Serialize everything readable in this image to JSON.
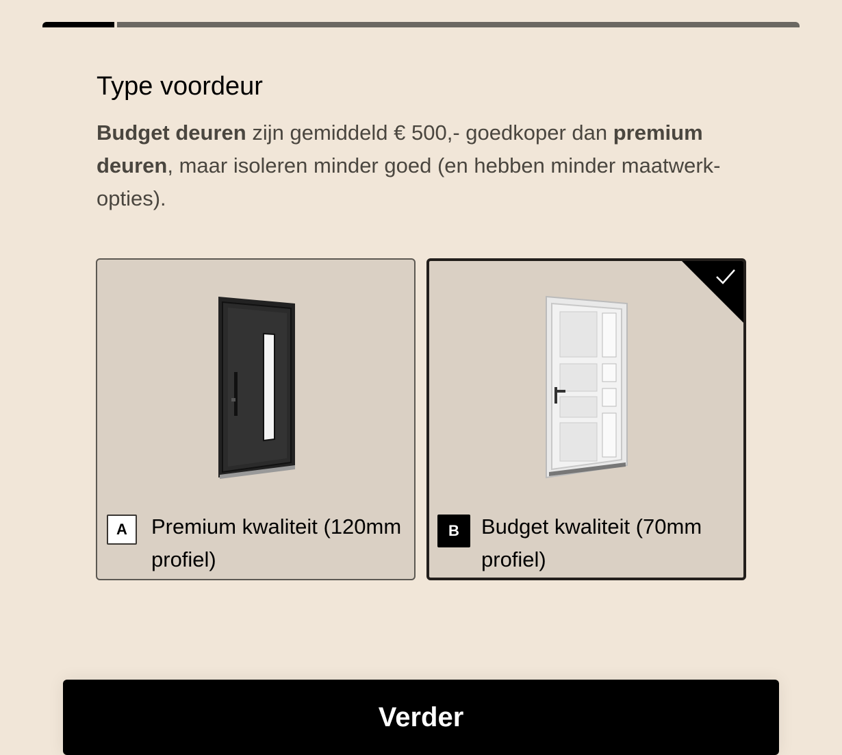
{
  "progress": {
    "current_step": 1,
    "fraction": 0.1
  },
  "question": {
    "title": "Type voordeur",
    "desc_bold1": "Budget deuren",
    "desc_text1": " zijn gemiddeld € 500,- goedkoper dan ",
    "desc_bold2": "premium deuren",
    "desc_text2": ", maar isoleren minder goed (en hebben minder maatwerk-opties)."
  },
  "options": [
    {
      "key": "A",
      "label": "Premium kwaliteit (120mm profiel)",
      "image": "dark-door",
      "selected": false
    },
    {
      "key": "B",
      "label": "Budget kwaliteit (70mm profiel)",
      "image": "white-door",
      "selected": true
    }
  ],
  "next_button": {
    "label": "Verder"
  },
  "colors": {
    "background": "#f1e6d8",
    "card": "#dad0c4",
    "accent": "#000000"
  }
}
